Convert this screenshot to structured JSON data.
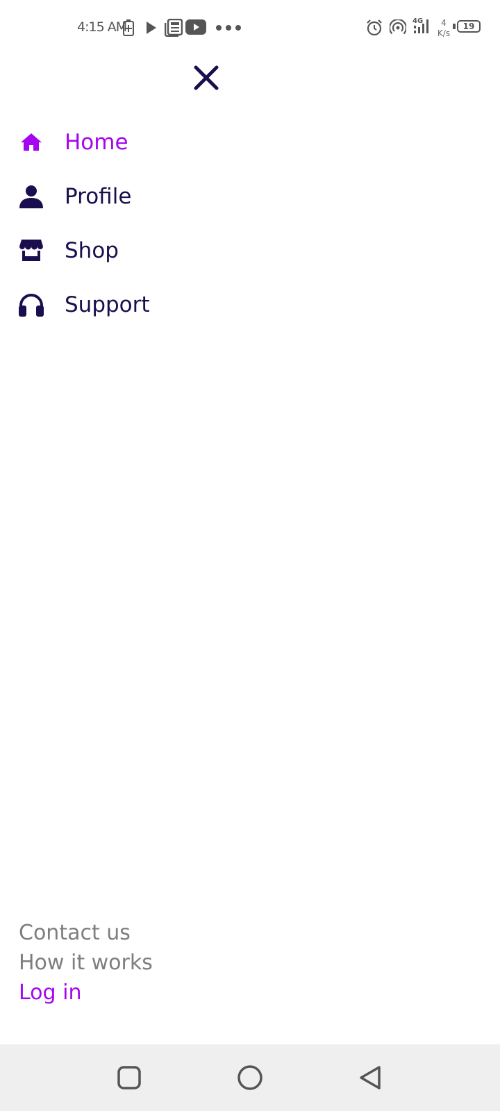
{
  "status_bar": {
    "time": "4:15 AM",
    "network_speed_value": "4",
    "network_speed_unit": "K/s",
    "battery_level": "19",
    "icons": [
      "battery-charging-icon",
      "play-icon",
      "news-icon",
      "youtube-icon",
      "more-dots-icon",
      "alarm-icon",
      "hotspot-icon",
      "signal-4g-icon",
      "battery-icon"
    ]
  },
  "menu": {
    "close_icon": "close-icon",
    "items": [
      {
        "label": "Home",
        "icon": "home-icon",
        "active": true
      },
      {
        "label": "Profile",
        "icon": "user-icon",
        "active": false
      },
      {
        "label": "Shop",
        "icon": "store-icon",
        "active": false
      },
      {
        "label": "Support",
        "icon": "headphones-icon",
        "active": false
      }
    ]
  },
  "footer": {
    "contact": "Contact us",
    "how_it_works": "How it works",
    "login": "Log in"
  },
  "nav_bar": {
    "icons": [
      "recents-icon",
      "home-circle-icon",
      "back-icon"
    ]
  },
  "colors": {
    "accent": "#a506f0",
    "text_dark": "#1b0e4e",
    "text_muted": "#7e7e7e",
    "nav_bg": "#efefef"
  }
}
